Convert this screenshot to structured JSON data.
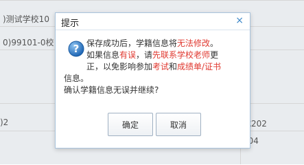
{
  "background": {
    "row1_left": ")测试学校10",
    "row2_left": "0)99101-0校",
    "row_mid_right": "2",
    "row3_left": ")2",
    "row3_right": "试202",
    "row4_right": "204"
  },
  "dialog": {
    "title": "提示",
    "close_glyph": "×",
    "message": {
      "p1": "保存成功后，学籍信息将",
      "p1_red": "无法修改",
      "p1_end": "。",
      "p2": "如果信息",
      "p2_red1": "有误",
      "p2_mid": "，请",
      "p2_red2": "先联系学校老师",
      "p2_end": "更",
      "p3": "正，以免影响参加",
      "p3_red1": "考试",
      "p3_mid": "和",
      "p3_red2": "成绩单/证书",
      "p4": "信息。",
      "p5": "确认学籍信息无误并继续?"
    },
    "confirm_label": "确定",
    "cancel_label": "取消"
  },
  "colors": {
    "accent": "#3c87c8",
    "warning_red": "#e0382f"
  }
}
